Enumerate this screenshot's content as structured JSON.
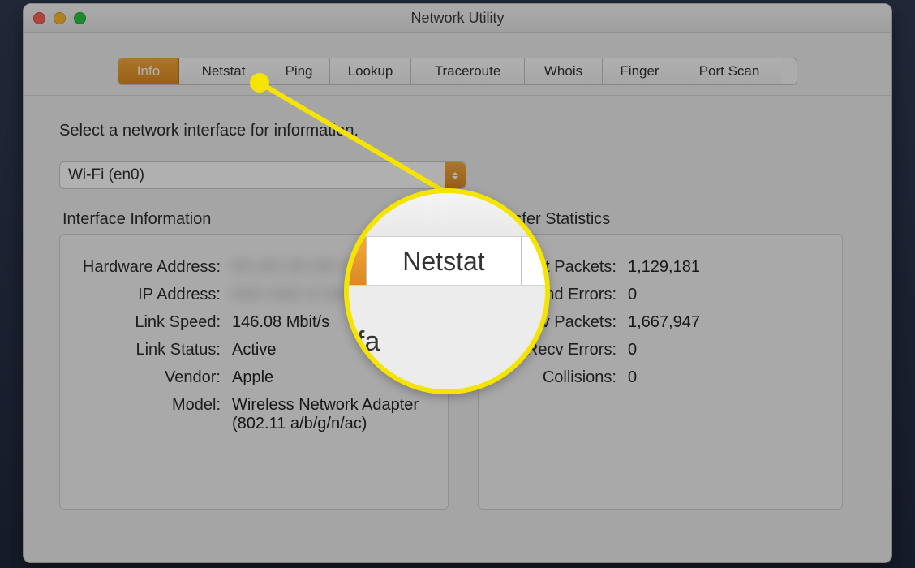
{
  "window": {
    "title": "Network Utility"
  },
  "tabs": {
    "info": "Info",
    "netstat": "Netstat",
    "ping": "Ping",
    "lookup": "Lookup",
    "traceroute": "Traceroute",
    "whois": "Whois",
    "finger": "Finger",
    "portscan": "Port Scan"
  },
  "instruction": "Select a network interface for information.",
  "interface_select": {
    "value": "Wi-Fi (en0)"
  },
  "left_panel": {
    "title": "Interface Information",
    "rows": {
      "hw_addr_label": "Hardware Address:",
      "hw_addr_value": "",
      "ip_label": "IP Address:",
      "ip_value": "",
      "speed_label": "Link Speed:",
      "speed_value": "146.08 Mbit/s",
      "status_label": "Link Status:",
      "status_value": "Active",
      "vendor_label": "Vendor:",
      "vendor_value": "Apple",
      "model_label": "Model:",
      "model_value": "Wireless Network Adapter (802.11 a/b/g/n/ac)"
    }
  },
  "right_panel": {
    "title": "Transfer Statistics",
    "rows": {
      "sent_label": "Sent Packets:",
      "sent_value": "1,129,181",
      "serr_label": "Send Errors:",
      "serr_value": "0",
      "recv_label": "Recv Packets:",
      "recv_value": "1,667,947",
      "rerr_label": "Recv Errors:",
      "rerr_value": "0",
      "coll_label": "Collisions:",
      "coll_value": "0"
    }
  },
  "callout": {
    "focus_tab": "Netstat",
    "partial_instruction_text": "interfa"
  },
  "accent": "#f5e400"
}
